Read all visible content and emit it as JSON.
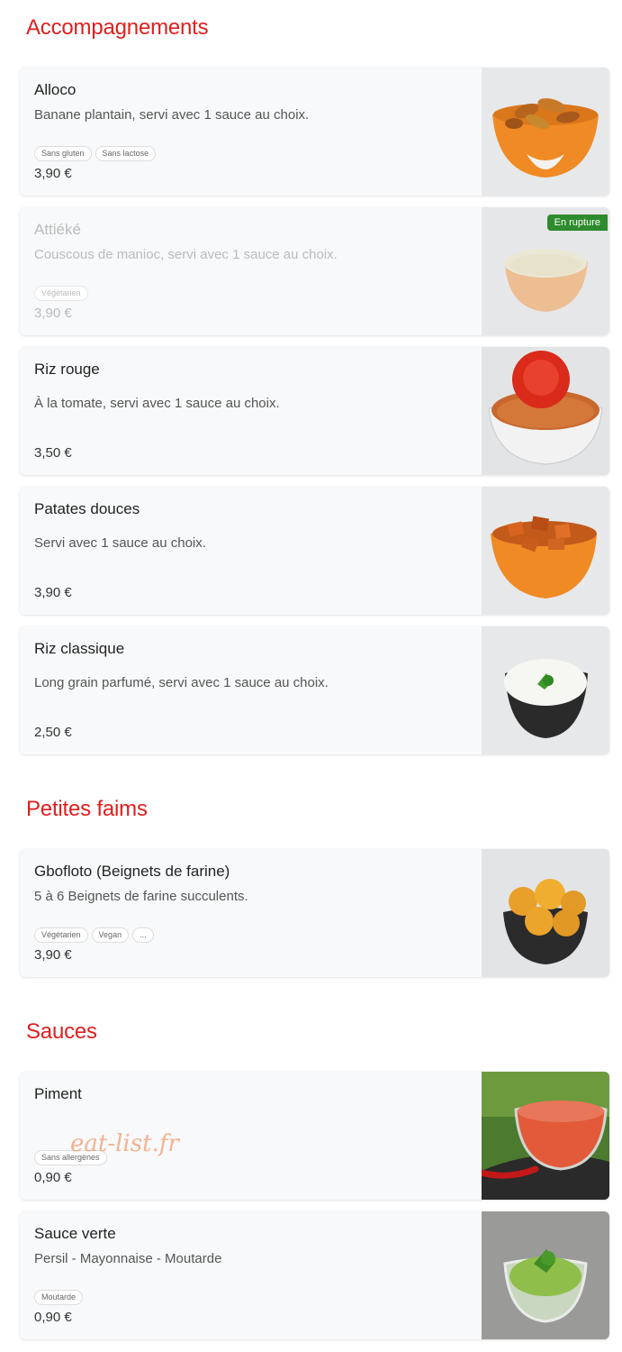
{
  "sections": {
    "accompagnements": "Accompagnements",
    "petites_faims": "Petites faims",
    "sauces": "Sauces"
  },
  "items": [
    {
      "name": "Alloco",
      "desc": "Banane plantain, servi avec 1 sauce au choix.",
      "tags": [
        "Sans gluten",
        "Sans lactose"
      ],
      "price": "3,90 €"
    },
    {
      "name": "Attiéké",
      "desc": "Couscous de manioc, servi avec 1 sauce au choix.",
      "tags": [
        "Végétarien"
      ],
      "price": "3,90 €",
      "badge": "En rupture"
    },
    {
      "name": "Riz rouge",
      "desc": "À la tomate, servi avec 1 sauce au choix.",
      "tags": [],
      "price": "3,50 €"
    },
    {
      "name": "Patates douces",
      "desc": "Servi avec 1 sauce au choix.",
      "tags": [],
      "price": "3,90 €"
    },
    {
      "name": "Riz classique",
      "desc": "Long grain parfumé, servi avec 1 sauce au choix.",
      "tags": [],
      "price": "2,50 €"
    },
    {
      "name": "Gbofloto (Beignets de farine)",
      "desc": "5 à 6 Beignets de farine succulents.",
      "tags": [
        "Végétarien",
        "Vegan",
        "..."
      ],
      "price": "3,90 €"
    },
    {
      "name": "Piment",
      "desc": "",
      "tags": [
        "Sans allergènes"
      ],
      "price": "0,90 €"
    },
    {
      "name": "Sauce verte",
      "desc": "Persil - Mayonnaise - Moutarde",
      "tags": [
        "Moutarde"
      ],
      "price": "0,90 €"
    }
  ],
  "watermark": "eat-list.fr",
  "colors": {
    "accent": "#e01e1e",
    "out_of_stock_badge": "#2e8b2e"
  }
}
